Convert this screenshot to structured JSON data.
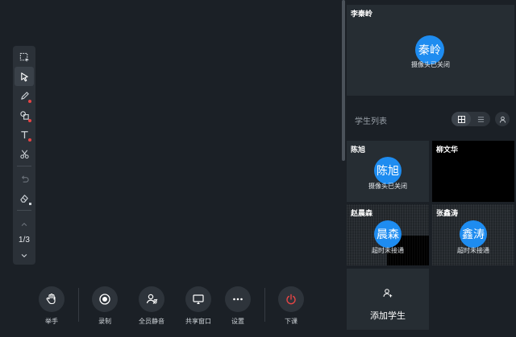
{
  "toolbar": {
    "tools": [
      {
        "name": "select-area-tool",
        "icon": "select-area-icon"
      },
      {
        "name": "pointer-tool",
        "icon": "cursor-icon"
      },
      {
        "name": "pen-tool",
        "icon": "pen-icon"
      },
      {
        "name": "shapes-tool",
        "icon": "shapes-icon"
      },
      {
        "name": "text-tool",
        "icon": "text-icon"
      },
      {
        "name": "cut-tool",
        "icon": "scissors-icon"
      },
      {
        "name": "undo-tool",
        "icon": "undo-icon"
      },
      {
        "name": "eraser-tool",
        "icon": "eraser-icon"
      }
    ],
    "page_indicator": "1/3"
  },
  "actions": {
    "raise_hand": "举手",
    "record": "录制",
    "mute_all": "全员静音",
    "share_window": "共享窗口",
    "settings": "设置",
    "end_class": "下课"
  },
  "teacher": {
    "name": "李秦岭",
    "avatar_text": "秦岭",
    "status": "摄像头已关闭"
  },
  "student_list": {
    "title": "学生列表",
    "students": [
      {
        "name": "陈旭",
        "avatar_text": "陈旭",
        "status": "摄像头已关闭"
      },
      {
        "name": "柳文华",
        "avatar_text": "",
        "status": ""
      },
      {
        "name": "赵晨森",
        "avatar_text": "晨森",
        "status": "超时未接通"
      },
      {
        "name": "张鑫涛",
        "avatar_text": "鑫涛",
        "status": "超时未接通"
      }
    ],
    "add_label": "添加学生"
  },
  "colors": {
    "accent": "#1e8cf0",
    "danger": "#e54545",
    "background": "#1b2026",
    "tile": "#262d33"
  }
}
